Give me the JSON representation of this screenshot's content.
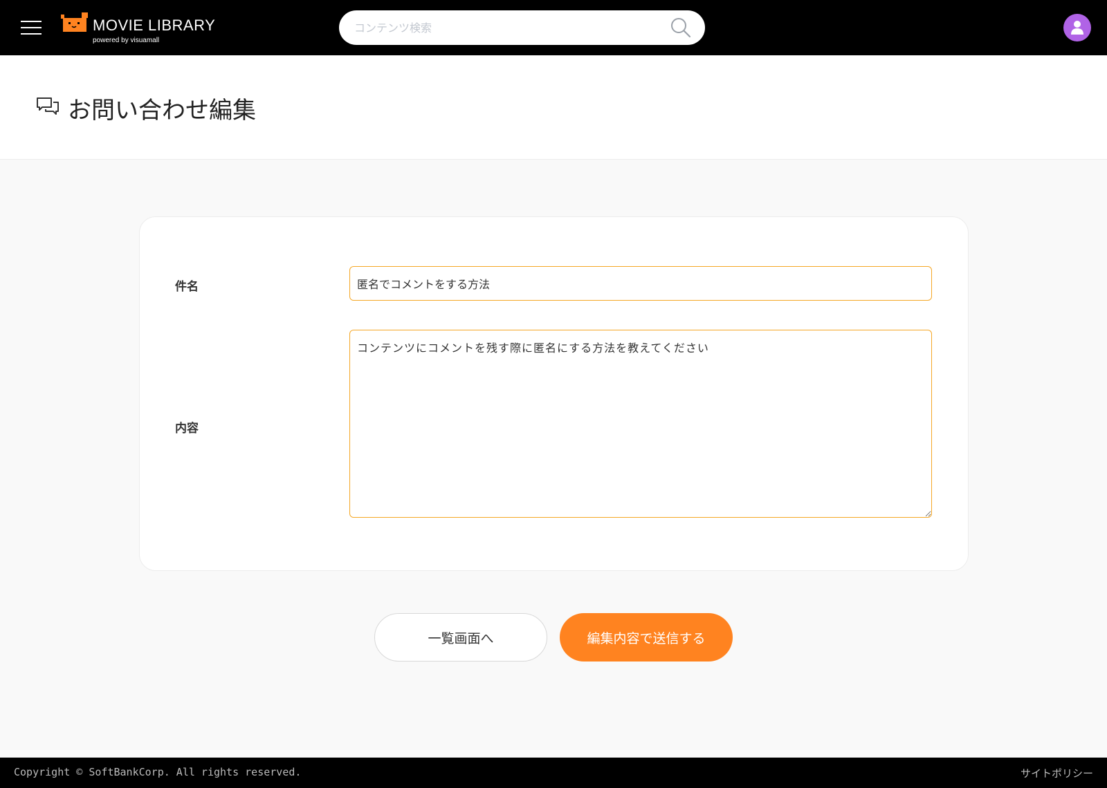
{
  "header": {
    "app_title": "MOVIE LIBRARY",
    "app_subtitle": "powered by visuamall",
    "search_placeholder": "コンテンツ検索",
    "search_value": ""
  },
  "page": {
    "title": "お問い合わせ編集"
  },
  "form": {
    "subject_label": "件名",
    "subject_value": "匿名でコメントをする方法",
    "content_label": "内容",
    "content_value": "コンテンツにコメントを残す際に匿名にする方法を教えてください"
  },
  "actions": {
    "back_label": "一覧画面へ",
    "submit_label": "編集内容で送信する"
  },
  "footer": {
    "copyright": "Copyright © SoftBankCorp. All rights reserved.",
    "policy_label": "サイトポリシー"
  },
  "colors": {
    "accent": "#ff8320",
    "input_border": "#f5a623",
    "avatar": "#b063e6",
    "header_bg": "#000000",
    "page_bg": "#f9f9f9"
  },
  "icons": [
    "menu-icon",
    "logo-icon",
    "search-icon",
    "user-icon",
    "chat-bubbles-icon"
  ]
}
